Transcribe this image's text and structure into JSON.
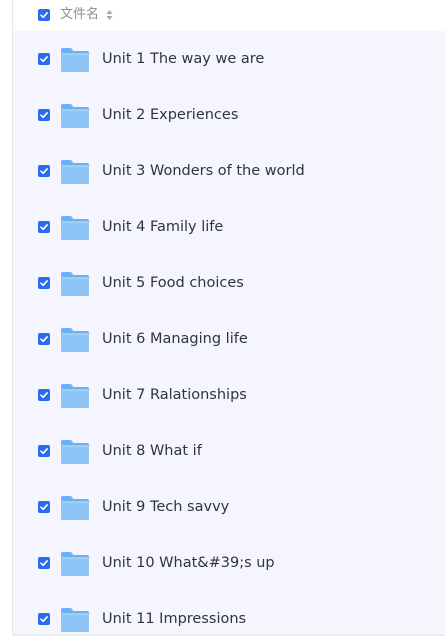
{
  "header": {
    "column_label": "文件名",
    "select_all_checked": true,
    "sort_icon": "sort-updown-icon"
  },
  "files": [
    {
      "name": "Unit 1 The way we are",
      "checked": true,
      "icon": "folder-icon"
    },
    {
      "name": "Unit 2 Experiences",
      "checked": true,
      "icon": "folder-icon"
    },
    {
      "name": "Unit 3 Wonders of the world",
      "checked": true,
      "icon": "folder-icon"
    },
    {
      "name": "Unit 4 Family life",
      "checked": true,
      "icon": "folder-icon"
    },
    {
      "name": "Unit 5 Food choices",
      "checked": true,
      "icon": "folder-icon"
    },
    {
      "name": "Unit 6 Managing life",
      "checked": true,
      "icon": "folder-icon"
    },
    {
      "name": "Unit 7 Ralationships",
      "checked": true,
      "icon": "folder-icon"
    },
    {
      "name": "Unit 8 What if",
      "checked": true,
      "icon": "folder-icon"
    },
    {
      "name": "Unit 9 Tech savvy",
      "checked": true,
      "icon": "folder-icon"
    },
    {
      "name": "Unit 10 What&#39;s up",
      "checked": true,
      "icon": "folder-icon"
    },
    {
      "name": "Unit 11 Impressions",
      "checked": true,
      "icon": "folder-icon"
    }
  ],
  "colors": {
    "checkbox": "#2a6bf2",
    "folder_front": "#8ec5f7",
    "folder_back": "#6fb0f2",
    "list_background": "#f5f6fd"
  }
}
